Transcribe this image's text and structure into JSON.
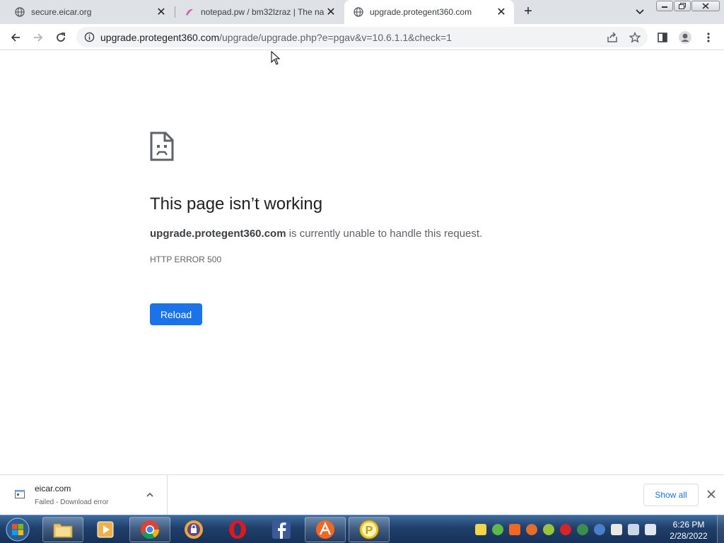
{
  "browser": {
    "tabs": [
      {
        "title": "secure.eicar.org",
        "active": false
      },
      {
        "title": "notepad.pw / bm32lzraz | The na",
        "active": false
      },
      {
        "title": "upgrade.protegent360.com",
        "active": true
      }
    ],
    "address": {
      "host": "upgrade.protegent360.com",
      "path": "/upgrade/upgrade.php?e=pgav&v=10.6.1.1&check=1"
    }
  },
  "error_page": {
    "title": "This page isn’t working",
    "host": "upgrade.protegent360.com",
    "message": " is currently unable to handle this request.",
    "code": "HTTP ERROR 500",
    "reload_label": "Reload",
    "accent": "#1a73e8"
  },
  "downloads": {
    "item": {
      "name": "eicar.com",
      "status": "Failed - Download error"
    },
    "show_all_label": "Show all"
  },
  "taskbar": {
    "apps": [
      "file-explorer",
      "media-player",
      "chrome",
      "browser-lock",
      "opera",
      "facebook",
      "avast-like",
      "protegent"
    ],
    "clock": {
      "time": "6:26 PM",
      "date": "2/28/2022"
    }
  }
}
